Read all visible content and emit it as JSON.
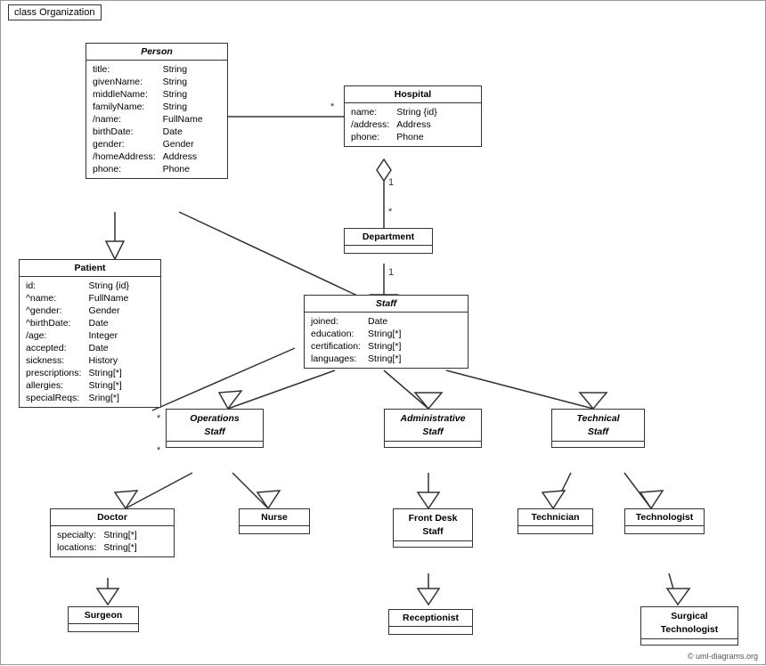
{
  "title": "class Organization",
  "copyright": "© uml-diagrams.org",
  "classes": {
    "person": {
      "name": "Person",
      "italic_header": true,
      "attrs": [
        {
          "name": "title:",
          "type": "String"
        },
        {
          "name": "givenName:",
          "type": "String"
        },
        {
          "name": "middleName:",
          "type": "String"
        },
        {
          "name": "familyName:",
          "type": "String"
        },
        {
          "name": "/name:",
          "type": "FullName"
        },
        {
          "name": "birthDate:",
          "type": "Date"
        },
        {
          "name": "gender:",
          "type": "Gender"
        },
        {
          "name": "/homeAddress:",
          "type": "Address"
        },
        {
          "name": "phone:",
          "type": "Phone"
        }
      ]
    },
    "hospital": {
      "name": "Hospital",
      "italic_header": false,
      "attrs": [
        {
          "name": "name:",
          "type": "String {id}"
        },
        {
          "name": "/address:",
          "type": "Address"
        },
        {
          "name": "phone:",
          "type": "Phone"
        }
      ]
    },
    "department": {
      "name": "Department",
      "italic_header": false,
      "attrs": []
    },
    "staff": {
      "name": "Staff",
      "italic_header": true,
      "attrs": [
        {
          "name": "joined:",
          "type": "Date"
        },
        {
          "name": "education:",
          "type": "String[*]"
        },
        {
          "name": "certification:",
          "type": "String[*]"
        },
        {
          "name": "languages:",
          "type": "String[*]"
        }
      ]
    },
    "patient": {
      "name": "Patient",
      "italic_header": false,
      "attrs": [
        {
          "name": "id:",
          "type": "String {id}"
        },
        {
          "name": "^name:",
          "type": "FullName"
        },
        {
          "name": "^gender:",
          "type": "Gender"
        },
        {
          "name": "^birthDate:",
          "type": "Date"
        },
        {
          "name": "/age:",
          "type": "Integer"
        },
        {
          "name": "accepted:",
          "type": "Date"
        },
        {
          "name": "sickness:",
          "type": "History"
        },
        {
          "name": "prescriptions:",
          "type": "String[*]"
        },
        {
          "name": "allergies:",
          "type": "String[*]"
        },
        {
          "name": "specialReqs:",
          "type": "Sring[*]"
        }
      ]
    },
    "operations_staff": {
      "name": "Operations\nStaff",
      "italic_header": true,
      "attrs": []
    },
    "administrative_staff": {
      "name": "Administrative\nStaff",
      "italic_header": true,
      "attrs": []
    },
    "technical_staff": {
      "name": "Technical\nStaff",
      "italic_header": true,
      "attrs": []
    },
    "doctor": {
      "name": "Doctor",
      "italic_header": false,
      "attrs": [
        {
          "name": "specialty:",
          "type": "String[*]"
        },
        {
          "name": "locations:",
          "type": "String[*]"
        }
      ]
    },
    "nurse": {
      "name": "Nurse",
      "italic_header": false,
      "attrs": []
    },
    "front_desk_staff": {
      "name": "Front Desk\nStaff",
      "italic_header": false,
      "attrs": []
    },
    "technician": {
      "name": "Technician",
      "italic_header": false,
      "attrs": []
    },
    "technologist": {
      "name": "Technologist",
      "italic_header": false,
      "attrs": []
    },
    "surgeon": {
      "name": "Surgeon",
      "italic_header": false,
      "attrs": []
    },
    "receptionist": {
      "name": "Receptionist",
      "italic_header": false,
      "attrs": []
    },
    "surgical_technologist": {
      "name": "Surgical\nTechnologist",
      "italic_header": false,
      "attrs": []
    }
  }
}
